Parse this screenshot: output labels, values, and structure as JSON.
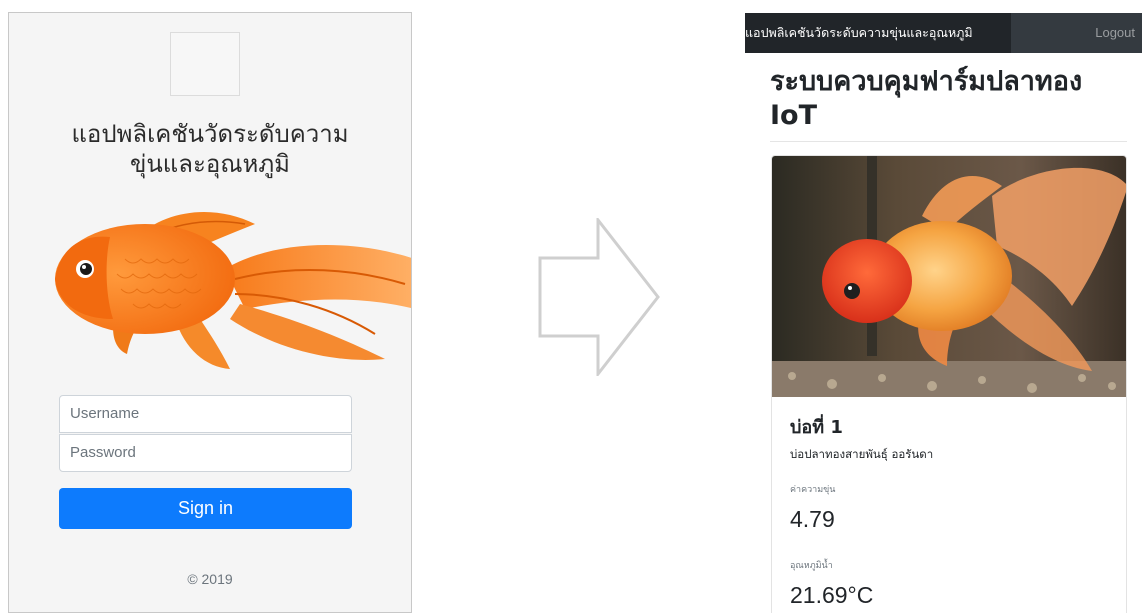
{
  "login": {
    "title": "แอปพลิเคชันวัดระดับความขุ่นและอุณหภูมิ",
    "username_placeholder": "Username",
    "password_placeholder": "Password",
    "signin_label": "Sign in",
    "copyright": "© 2019"
  },
  "dashboard": {
    "navbar": {
      "brand": "แอปพลิเคชันวัดระดับความขุ่นและอุณหภูมิ",
      "logout_label": "Logout"
    },
    "title": "ระบบควบคุมฟาร์มปลาทอง IoT",
    "card": {
      "pond_title": "บ่อที่ 1",
      "pond_subtitle": "บ่อปลาทองสายพันธุ์ ออรันดา",
      "turbidity_label": "ค่าความขุ่น",
      "turbidity_value": "4.79",
      "temperature_label": "อุณหภูมิน้ำ",
      "temperature_value": "21.69°C"
    }
  },
  "colors": {
    "primary_button": "#0d7bfd",
    "navbar": "#343a40",
    "fish_orange": "#f58220"
  },
  "icons": [
    "goldfish-illustration",
    "right-arrow-icon",
    "goldfish-photo"
  ]
}
